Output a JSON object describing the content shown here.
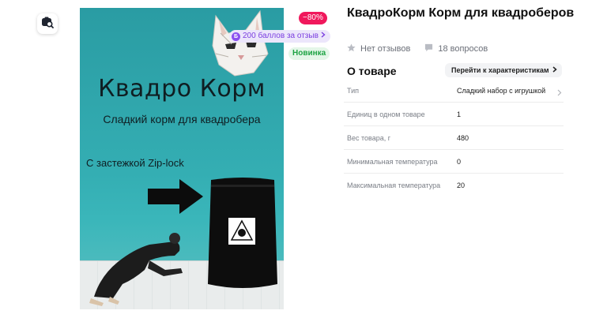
{
  "colors": {
    "accent_discount": "#f0185c",
    "accent_points": "#7b3fe0",
    "accent_new": "#1ea344",
    "image_bg": "#34aeb3"
  },
  "toolbar": {
    "photo_search_icon": "camera-search-icon"
  },
  "image": {
    "title": "Квадро Корм",
    "subtitle": "Сладкий корм для квадробера",
    "zip_note": "С застежкой Zip-lock"
  },
  "badges": {
    "discount": "−80%",
    "points": "200 баллов за отзыв",
    "points_icon_letter": "Б",
    "new": "Новинка"
  },
  "product": {
    "title": "КвадроКорм Корм для квадроберов",
    "reviews": "Нет отзывов",
    "questions": "18 вопросов"
  },
  "about": {
    "title": "О товаре",
    "characteristics_link": "Перейти к характеристикам",
    "properties": [
      {
        "name": "Тип",
        "value": "Сладкий набор с игрушкой"
      },
      {
        "name": "Единиц в одном товаре",
        "value": "1"
      },
      {
        "name": "Вес товара, г",
        "value": "480"
      },
      {
        "name": "Минимальная температура",
        "value": "0"
      },
      {
        "name": "Максимальная температура",
        "value": "20"
      }
    ]
  }
}
